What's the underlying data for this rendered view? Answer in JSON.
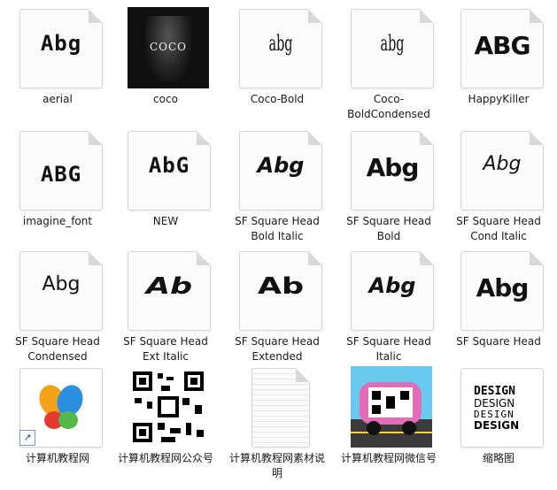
{
  "files": [
    {
      "label": "aerial",
      "type": "font",
      "sample": "Abg",
      "style": "pixel"
    },
    {
      "label": "coco",
      "type": "image",
      "sample": "COCO",
      "style": "photo"
    },
    {
      "label": "Coco-Bold",
      "type": "font",
      "sample": "abg",
      "style": "cond"
    },
    {
      "label": "Coco-BoldCondensed",
      "type": "font",
      "sample": "abg",
      "style": "cond"
    },
    {
      "label": "HappyKiller",
      "type": "font",
      "sample": "ABG",
      "style": "bold"
    },
    {
      "label": "imagine_font",
      "type": "font",
      "sample": "ABG",
      "style": "pixel"
    },
    {
      "label": "NEW",
      "type": "font",
      "sample": "AbG",
      "style": "pixel"
    },
    {
      "label": "SF Square Head Bold Italic",
      "type": "font",
      "sample": "Abg",
      "style": "italic"
    },
    {
      "label": "SF Square Head Bold",
      "type": "font",
      "sample": "Abg",
      "style": "bold"
    },
    {
      "label": "SF Square Head Cond Italic",
      "type": "font",
      "sample": "Abg",
      "style": "light"
    },
    {
      "label": "SF Square Head Condensed",
      "type": "font",
      "sample": "Abg",
      "style": "light"
    },
    {
      "label": "SF Square Head Ext Italic",
      "type": "font",
      "sample": "Ab",
      "style": "wide"
    },
    {
      "label": "SF Square Head Extended",
      "type": "font",
      "sample": "Ab",
      "style": "wide"
    },
    {
      "label": "SF Square Head Italic",
      "type": "font",
      "sample": "Abg",
      "style": "italic"
    },
    {
      "label": "SF Square Head",
      "type": "font",
      "sample": "Abg",
      "style": "bold"
    },
    {
      "label": "计算机教程网",
      "type": "shortcut",
      "sample": ""
    },
    {
      "label": "计算机教程网公众号",
      "type": "image",
      "sample": ""
    },
    {
      "label": "计算机教程网素材说明",
      "type": "document",
      "sample": ""
    },
    {
      "label": "计算机教程网微信号",
      "type": "image",
      "sample": ""
    },
    {
      "label": "缩略图",
      "type": "image",
      "sample": "DESIGN"
    }
  ],
  "colors": {
    "selection": "#cce8ff",
    "text": "#1a1a1a",
    "folder_page": "#fbfbfb"
  }
}
